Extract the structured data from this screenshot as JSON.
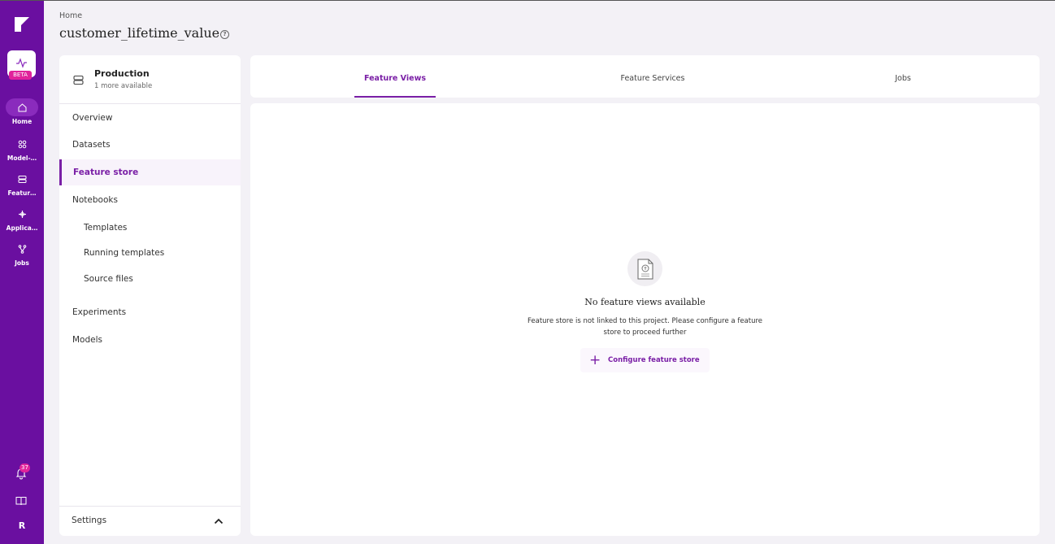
{
  "rail": {
    "app_badge": "BETA",
    "items": [
      {
        "label": "Home",
        "icon": "home-icon"
      },
      {
        "label": "Model-…",
        "icon": "model-registry-icon"
      },
      {
        "label": "Featur…",
        "icon": "feature-store-icon"
      },
      {
        "label": "Applica…",
        "icon": "applications-icon"
      },
      {
        "label": "Jobs",
        "icon": "jobs-icon"
      }
    ],
    "notification_count": "37",
    "user_initial": "R"
  },
  "header": {
    "breadcrumb": "Home",
    "title": "customer_lifetime_value"
  },
  "sidebar": {
    "environment": {
      "name": "Production",
      "sub": "1 more available"
    },
    "items": [
      {
        "label": "Overview"
      },
      {
        "label": "Datasets"
      },
      {
        "label": "Feature store"
      },
      {
        "label": "Notebooks"
      },
      {
        "label": "Templates"
      },
      {
        "label": "Running templates"
      },
      {
        "label": "Source files"
      },
      {
        "label": "Experiments"
      },
      {
        "label": "Models"
      }
    ],
    "active_item": "Feature store",
    "settings_label": "Settings"
  },
  "tabs": [
    {
      "label": "Feature Views"
    },
    {
      "label": "Feature Services"
    },
    {
      "label": "Jobs"
    }
  ],
  "active_tab": "Feature Views",
  "empty_state": {
    "title": "No feature views available",
    "description": "Feature store is not linked to this project. Please configure a feature store to proceed further",
    "button_label": "Configure feature store"
  },
  "colors": {
    "rail": "#6a0fa0",
    "accent": "#7a1fa6",
    "badge": "#e0239b"
  }
}
